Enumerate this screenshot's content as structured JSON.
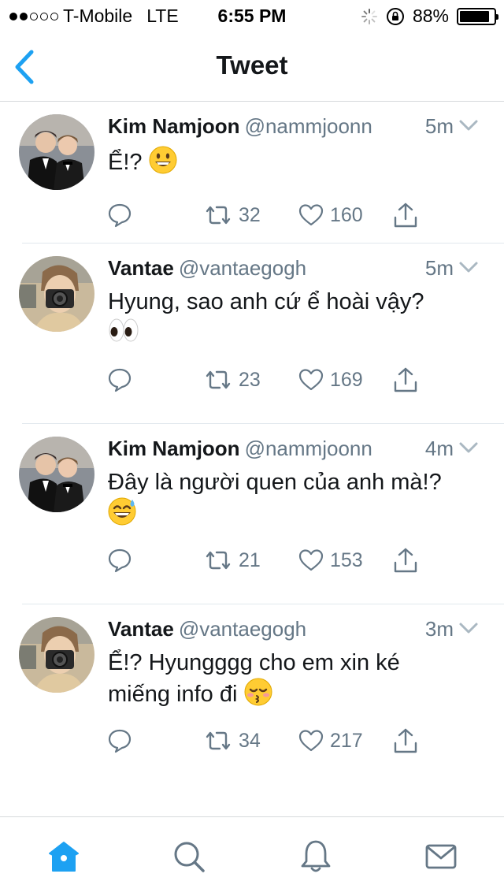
{
  "status": {
    "carrier": "T-Mobile",
    "network": "LTE",
    "time": "6:55 PM",
    "battery": "88%",
    "battery_level": 0.88
  },
  "nav": {
    "title": "Tweet",
    "back_icon": "chevron-left-icon"
  },
  "colors": {
    "accent": "#1da1f2",
    "text": "#14171a",
    "secondary": "#657786",
    "divider": "#e1e8ed"
  },
  "tweets": [
    {
      "name": "Kim Namjoon",
      "handle": "@nammjoonn",
      "time": "5m",
      "text": "Ể!?",
      "emoji": "grinning-face",
      "replies": "",
      "retweets": "32",
      "likes": "160"
    },
    {
      "name": "Vantae",
      "handle": "@vantaegogh",
      "time": "5m",
      "text": "Hyung, sao anh cứ ể hoài vậy?",
      "emoji": "eyes",
      "replies": "",
      "retweets": "23",
      "likes": "169"
    },
    {
      "name": "Kim Namjoon",
      "handle": "@nammjoonn",
      "time": "4m",
      "text": "Đây là người quen của anh mà!?",
      "emoji": "grinning-face-with-sweat",
      "replies": "",
      "retweets": "21",
      "likes": "153"
    },
    {
      "name": "Vantae",
      "handle": "@vantaegogh",
      "time": "3m",
      "text": "Ể!? Hyungggg cho em xin ké miếng info đi",
      "emoji": "kissing-face-with-closed-eyes",
      "replies": "",
      "retweets": "34",
      "likes": "217"
    }
  ],
  "tabs": [
    "home-icon",
    "search-icon",
    "notifications-icon",
    "messages-icon"
  ]
}
